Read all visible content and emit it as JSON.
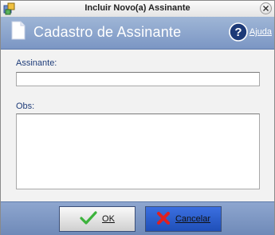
{
  "window": {
    "title": "Incluir Novo(a) Assinante"
  },
  "header": {
    "title": "Cadastro de Assinante",
    "help_label": "Ajuda"
  },
  "form": {
    "assinante": {
      "label": "Assinante:",
      "value": ""
    },
    "obs": {
      "label": "Obs:",
      "value": ""
    }
  },
  "footer": {
    "ok_label": "OK",
    "cancel_label": "Cancelar"
  },
  "icons": {
    "title_icon": "app-window-icon",
    "close": "close-icon",
    "document": "document-icon",
    "help": "help-icon",
    "ok": "checkmark-icon",
    "cancel": "x-icon"
  },
  "colors": {
    "header_blue": "#8aa3cf",
    "footer_blue": "#7b96c4",
    "label_blue": "#1f3d7a",
    "cancel_button": "#2a5bd0",
    "ok_check": "#3cb33c",
    "cancel_x": "#e02020"
  }
}
